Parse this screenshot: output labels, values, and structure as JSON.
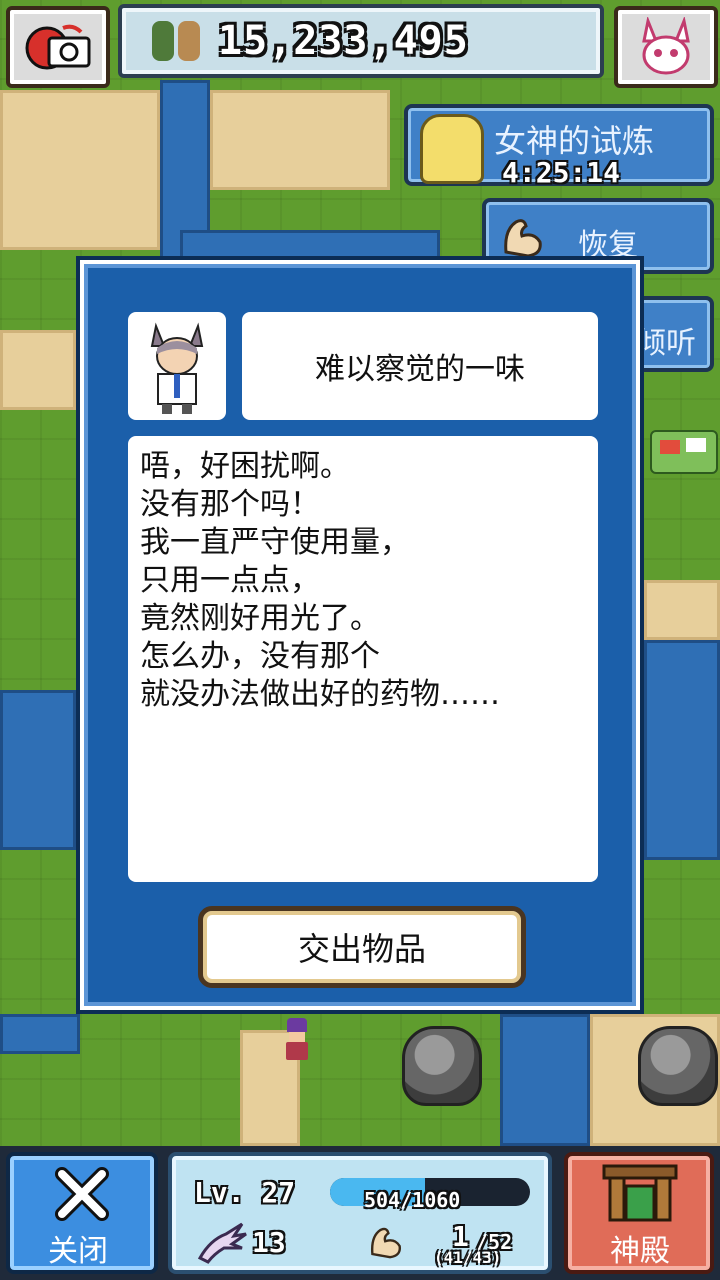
{
  "top_bar": {
    "score": "15,233,495"
  },
  "side_menu": {
    "trial_label": "女神的试炼",
    "trial_timer": "4:25:14",
    "recover_label": "恢复",
    "listen_label": "倾听"
  },
  "dialog": {
    "title": "难以察觉的一味",
    "lines": [
      "唔，好困扰啊。",
      "没有那个吗！",
      "我一直严守使用量，",
      "只用一点点，",
      "竟然刚好用光了。",
      "怎么办，没有那个",
      "就没办法做出好的药物……"
    ],
    "submit_label": "交出物品"
  },
  "bottom_bar": {
    "close_label": "关闭",
    "level_label": "Lv. 27",
    "exp_text": "504/1060",
    "exp_progress": 0.475,
    "attack_value": "13",
    "strength_value": "1",
    "strength_max": "/52",
    "strength_sub": "(41/43)",
    "temple_label": "神殿"
  },
  "colors": {
    "dialog_blue": "#1b5faa",
    "side_button_blue": "#3f80c7",
    "close_blue": "#3c8ee0",
    "temple_red": "#e06c58",
    "grass": "#5f9d2e",
    "water": "#2f6fb5",
    "sand": "#e7cf9b"
  },
  "icons": [
    "camera-icon",
    "party-icon",
    "bunny-mask-icon",
    "goddess-icon",
    "muscle-icon",
    "ear-icon",
    "scientist-portrait-icon",
    "close-x-icon",
    "claw-icon",
    "temple-gate-icon"
  ]
}
